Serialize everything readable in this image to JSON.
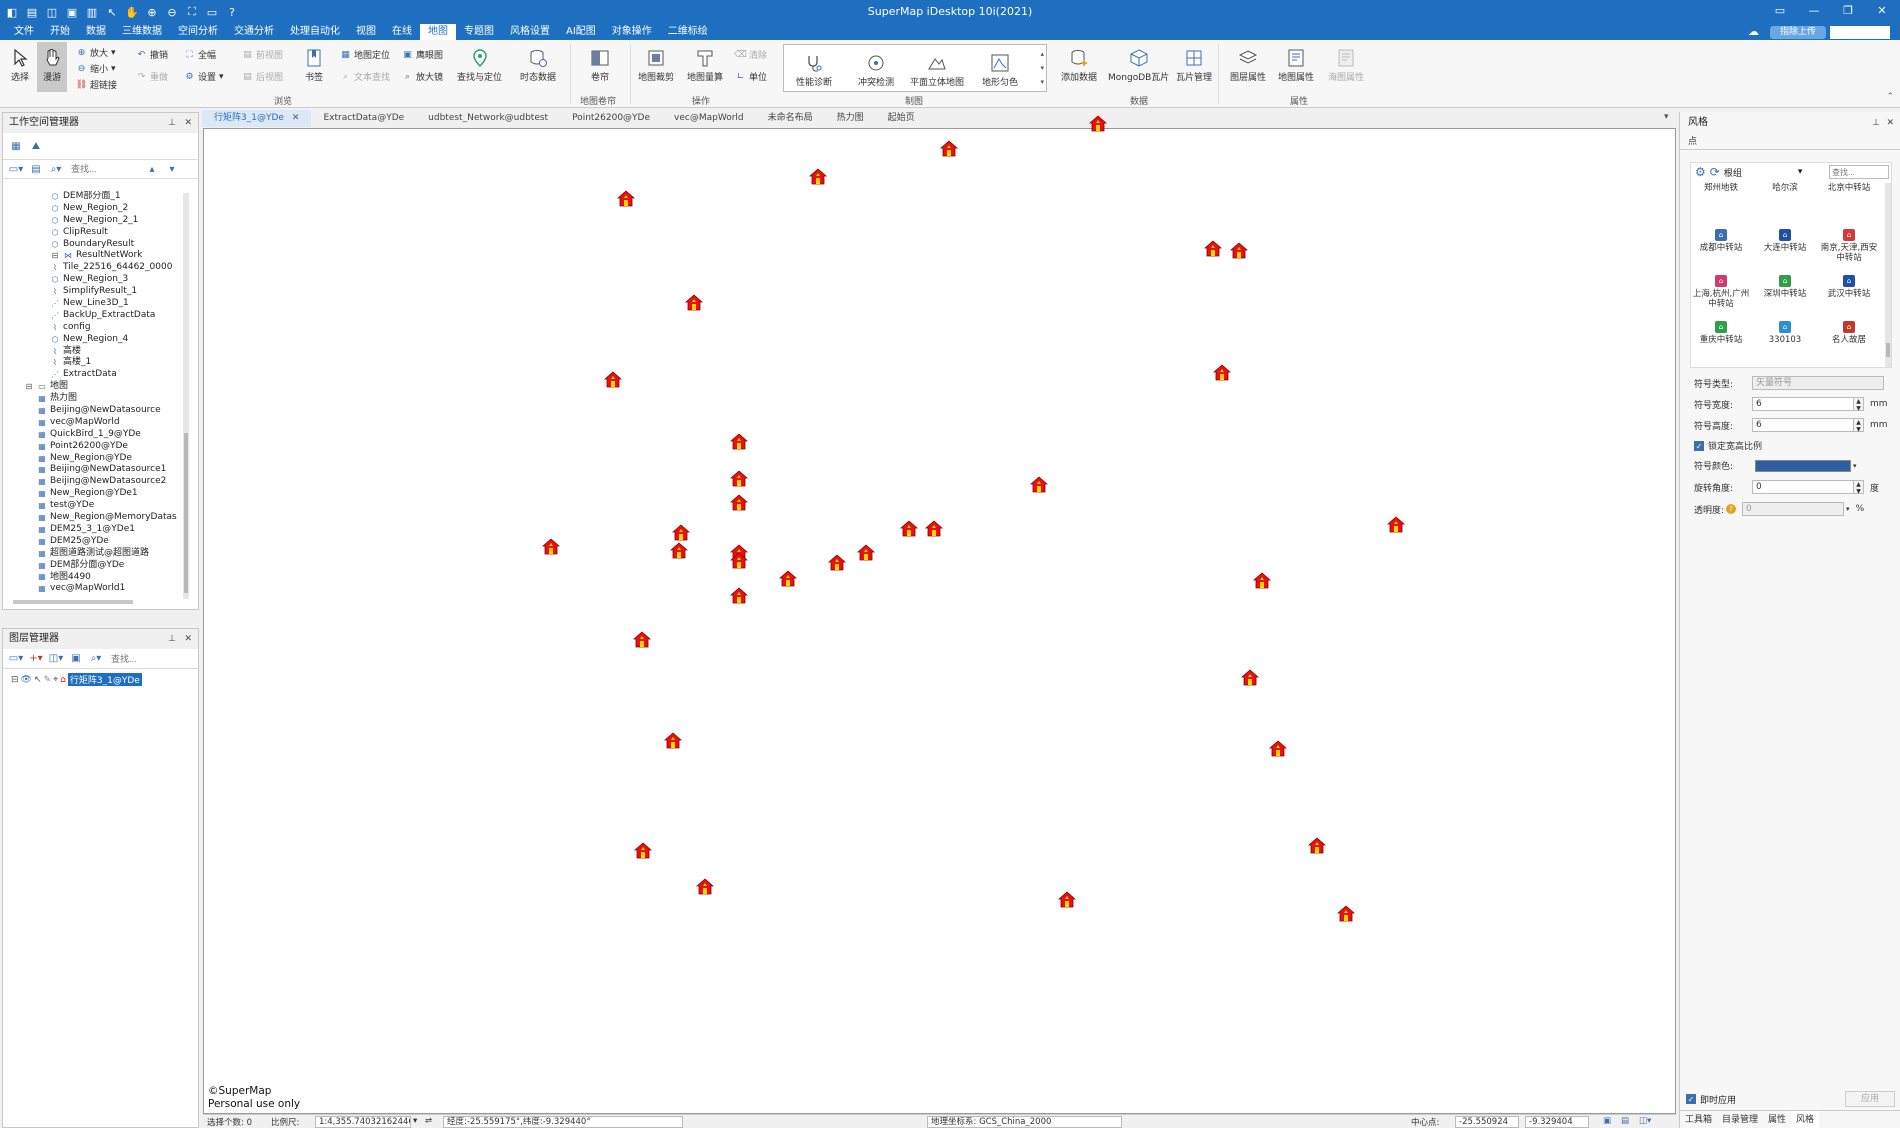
{
  "window": {
    "title": "SuperMap iDesktop 10i(2021)"
  },
  "menu": {
    "items": [
      "文件",
      "开始",
      "数据",
      "三维数据",
      "空间分析",
      "交通分析",
      "处理自动化",
      "视图",
      "在线",
      "地图",
      "专题图",
      "风格设置",
      "AI配图",
      "对象操作",
      "二维标绘"
    ],
    "active_index": 9,
    "upload_label": "指除上传"
  },
  "ribbon": {
    "select": "选择",
    "pan": "漫游",
    "zoom_in": "放大",
    "zoom_out": "缩小",
    "hyperlink": "超链接",
    "undo": "撤销",
    "redo": "重做",
    "full_extent": "全幅",
    "settings": "设置",
    "prev_view": "前视图",
    "next_view": "后视图",
    "bookmark": "书签",
    "map_locate": "地图定位",
    "text_search": "文本查找",
    "eagle_eye": "鹰眼图",
    "magnifier": "放大镜",
    "find_locate": "查找与定位",
    "temporal_data": "时态数据",
    "scroll_map": "卷帘",
    "map_crop": "地图裁剪",
    "map_measure": "地图量算",
    "clear": "清除",
    "unit": "单位",
    "perf_diag": "性能诊断",
    "conflict_check": "冲突检测",
    "plane_stereo": "平面立体地图",
    "terrain_color": "地形匀色",
    "add_data": "添加数据",
    "mongodb_tiles": "MongoDB瓦片",
    "tile_manage": "瓦片管理",
    "layer_props": "图层属性",
    "map_props": "地图属性",
    "chart_props": "海图属性",
    "groups": {
      "browse": "浏览",
      "map_scroll": "地图卷帘",
      "operate": "操作",
      "mapping": "制图",
      "data": "数据",
      "props": "属性"
    }
  },
  "workspace_panel": {
    "title": "工作空间管理器",
    "search_placeholder": "查找...",
    "tree": [
      {
        "label": "DEM部分面_1",
        "icon": "region",
        "indent": 3
      },
      {
        "label": "New_Region_2",
        "icon": "region",
        "indent": 3
      },
      {
        "label": "New_Region_2_1",
        "icon": "region",
        "indent": 3
      },
      {
        "label": "ClipResult",
        "icon": "region",
        "indent": 3
      },
      {
        "label": "BoundaryResult",
        "icon": "region",
        "indent": 3
      },
      {
        "label": "ResultNetWork",
        "icon": "network",
        "indent": 3,
        "expander": true
      },
      {
        "label": "Tile_22516_64462_0000",
        "icon": "line",
        "indent": 3
      },
      {
        "label": "New_Region_3",
        "icon": "region",
        "indent": 3
      },
      {
        "label": "SimplifyResult_1",
        "icon": "line",
        "indent": 3
      },
      {
        "label": "New_Line3D_1",
        "icon": "line3d",
        "indent": 3
      },
      {
        "label": "BackUp_ExtractData",
        "icon": "line3d",
        "indent": 3
      },
      {
        "label": "config",
        "icon": "line",
        "indent": 3
      },
      {
        "label": "New_Region_4",
        "icon": "region",
        "indent": 3
      },
      {
        "label": "高楼",
        "icon": "line",
        "indent": 3
      },
      {
        "label": "高楼_1",
        "icon": "line",
        "indent": 3
      },
      {
        "label": "ExtractData",
        "icon": "line3d",
        "indent": 3
      },
      {
        "label": "地图",
        "icon": "folder",
        "indent": 1,
        "expander": true
      },
      {
        "label": "热力图",
        "icon": "map",
        "indent": 2
      },
      {
        "label": "Beijing@NewDatasource",
        "icon": "map",
        "indent": 2
      },
      {
        "label": "vec@MapWorld",
        "icon": "map",
        "indent": 2
      },
      {
        "label": "QuickBird_1_9@YDe",
        "icon": "map",
        "indent": 2
      },
      {
        "label": "Point26200@YDe",
        "icon": "map",
        "indent": 2
      },
      {
        "label": "New_Region@YDe",
        "icon": "map",
        "indent": 2
      },
      {
        "label": "Beijing@NewDatasource1",
        "icon": "map",
        "indent": 2
      },
      {
        "label": "Beijing@NewDatasource2",
        "icon": "map",
        "indent": 2
      },
      {
        "label": "New_Region@YDe1",
        "icon": "map",
        "indent": 2
      },
      {
        "label": "test@YDe",
        "icon": "map",
        "indent": 2
      },
      {
        "label": "New_Region@MemoryDatas",
        "icon": "map",
        "indent": 2
      },
      {
        "label": "DEM25_3_1@YDe1",
        "icon": "map",
        "indent": 2
      },
      {
        "label": "DEM25@YDe",
        "icon": "map",
        "indent": 2
      },
      {
        "label": "超图道路测试@超图道路",
        "icon": "map",
        "indent": 2
      },
      {
        "label": "DEM部分面@YDe",
        "icon": "map",
        "indent": 2
      },
      {
        "label": "地图4490",
        "icon": "map",
        "indent": 2
      },
      {
        "label": "vec@MapWorld1",
        "icon": "map",
        "indent": 2
      }
    ]
  },
  "layer_panel": {
    "title": "图层管理器",
    "search_placeholder": "查找...",
    "layer_name": "行矩阵3_1@YDe"
  },
  "tabs": [
    "行矩阵3_1@YDe",
    "ExtractData@YDe",
    "udbtest_Network@udbtest",
    "Point26200@YDe",
    "vec@MapWorld",
    "未命名布局",
    "热力图",
    "起始页"
  ],
  "active_tab": 0,
  "map": {
    "copyright_line1": "©SuperMap",
    "copyright_line2": "Personal use only",
    "marker_color": "#e8110e",
    "marker_icon": "house-marker-icon"
  },
  "style_panel": {
    "title": "风格",
    "subtitle": "点",
    "group_select": "根组",
    "search_placeholder": "查找...",
    "symbols": [
      {
        "label": "郑州地铁",
        "color": ""
      },
      {
        "label": "哈尔滨",
        "color": ""
      },
      {
        "label": "北京中转站",
        "color": ""
      },
      {
        "label": "成都中转站",
        "color": "#3a6fb0"
      },
      {
        "label": "大连中转站",
        "color": "#1f4fa8"
      },
      {
        "label": "南京,天津,西安中转站",
        "color": "#d23a3a"
      },
      {
        "label": "上海,杭州,广州中转站",
        "color": "#d23a6a"
      },
      {
        "label": "深圳中转站",
        "color": "#2f9e44"
      },
      {
        "label": "武汉中转站",
        "color": "#1f4fa8"
      },
      {
        "label": "重庆中转站",
        "color": "#2f9e44"
      },
      {
        "label": "330103",
        "color": "#2a8fd4"
      },
      {
        "label": "名人故居",
        "color": "#c0392b"
      }
    ],
    "symbol_type_label": "符号类型:",
    "symbol_type_value": "矢量符号",
    "width_label": "符号宽度:",
    "width_value": "6",
    "height_label": "符号高度:",
    "height_value": "6",
    "unit_mm": "mm",
    "lock_ratio_label": "锁定宽高比例",
    "color_label": "符号颜色:",
    "symbol_color": "#2e5fa3",
    "rotation_label": "旋转角度:",
    "rotation_value": "0",
    "rotation_unit": "度",
    "opacity_label": "透明度:",
    "opacity_value": "0",
    "opacity_unit": "%",
    "instant_apply": "即时应用",
    "apply": "应用",
    "bottom_tabs": [
      "工具箱",
      "目录管理",
      "属性",
      "风格"
    ],
    "active_bottom_tab": 3
  },
  "statusbar": {
    "selected_count": "选择个数: 0",
    "scale_label": "比例尺:",
    "scale_value": "1:4,355.74032162446",
    "coords": "经度:-25.559175°,纬度:-9.329440°",
    "crs": "地理坐标系: GCS_China_2000",
    "center_label": "中心点:",
    "center_x": "-25.550924",
    "center_y": "-9.329404"
  }
}
